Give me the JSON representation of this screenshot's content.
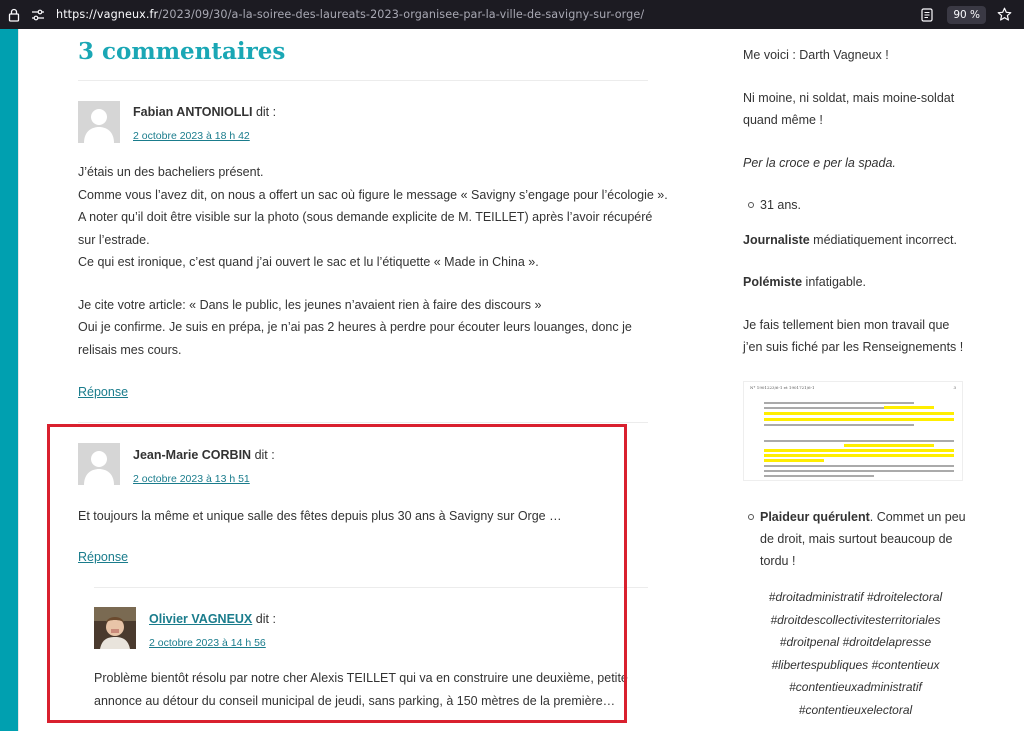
{
  "browser": {
    "url_host": "https://vagneux.fr",
    "url_path": "/2023/09/30/a-la-soiree-des-laureats-2023-organisee-par-la-ville-de-savigny-sur-orge/",
    "zoom": "90 %"
  },
  "comments_title": "3 commentaires",
  "comments": [
    {
      "author": "Fabian ANTONIOLLI",
      "says": "dit :",
      "date": "2 octobre 2023 à 18 h 42",
      "lines": [
        "J’étais un des bacheliers présent.",
        "Comme vous l’avez dit, on nous a offert un sac où figure le message « Savigny s’engage pour l’écologie ».",
        "A noter qu’il doit être visible sur la photo (sous demande explicite de M. TEILLET) après l’avoir récupéré",
        "sur l’estrade.",
        "Ce qui est ironique, c’est quand j’ai ouvert le sac et lu l’étiquette « Made in China ».",
        "",
        "Je cite votre article: « Dans le public, les jeunes n’avaient rien à faire des discours »",
        "Oui je confirme. Je suis en prépa, je n’ai pas 2 heures à perdre pour écouter leurs louanges, donc je",
        "relisais mes cours."
      ],
      "reply": "Réponse"
    },
    {
      "author": "Jean-Marie CORBIN",
      "says": "dit :",
      "date": "2 octobre 2023 à 13 h 51",
      "lines": [
        "Et toujours la même et unique salle des fêtes depuis plus 30 ans à Savigny sur Orge …"
      ],
      "reply": "Réponse"
    },
    {
      "author": "Olivier VAGNEUX",
      "says": "dit :",
      "date": "2 octobre 2023 à 14 h 56",
      "lines": [
        "Problème bientôt résolu par notre cher Alexis TEILLET qui va en construire une deuxième, petite",
        "annonce au détour du conseil municipal de jeudi, sans parking, à 150 mètres de la première…"
      ]
    }
  ],
  "sidebar": {
    "intro": "Me voici : Darth Vagneux !",
    "line2a": "Ni moine, ni soldat, mais moine-soldat",
    "line2b": "quand même !",
    "motto": "Per la croce e per la spada.",
    "age": "31 ans.",
    "journaliste_b": "Journaliste",
    "journaliste_t": " médiatiquement incorrect.",
    "polemiste_b": "Polémiste",
    "polemiste_t": " infatigable.",
    "fiche_a": "Je fais tellement bien mon travail que",
    "fiche_b": "j’en suis fiché par les Renseignements !",
    "doc_header_left": "N° 1901223/6-1 et 1901721/6-1",
    "doc_header_right": "3",
    "plaideur_b": "Plaideur quérulent",
    "plaideur_t": ". Commet un peu",
    "plaideur_2": "de droit, mais surtout beaucoup de",
    "plaideur_3": "tordu !",
    "hashtags": [
      "#droitadministratif #droitelectoral",
      "#droitdescollectivitesterritoriales",
      "#droitpenal #droitdelapresse",
      "#libertespubliques #contentieux",
      "#contentieuxadministratif",
      "#contentieuxelectoral"
    ]
  },
  "colors": {
    "accent": "#1aa7b5",
    "link": "#1a7c8c",
    "highlight_border": "#d9202e",
    "strip": "#00a0b0"
  }
}
